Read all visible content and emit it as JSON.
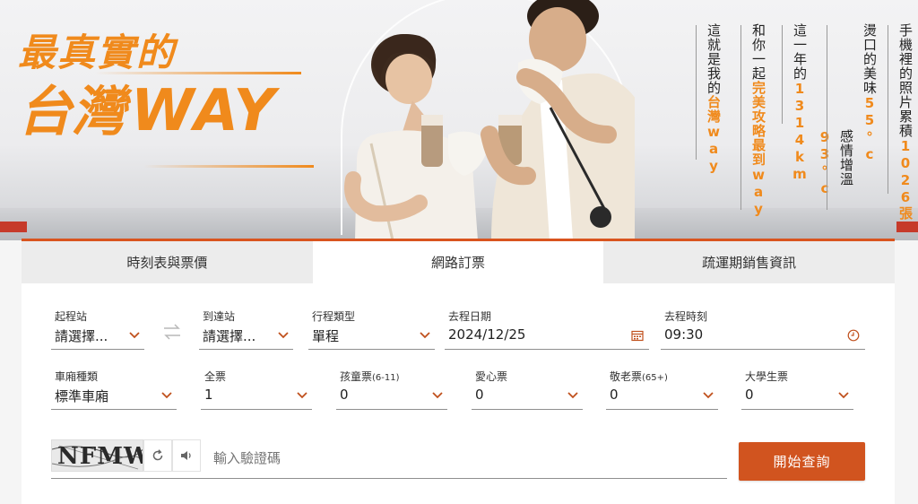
{
  "hero": {
    "slogan_line1": "最真實的",
    "slogan_line2_cn": "台灣",
    "slogan_line2_way": "WAY",
    "columns": [
      {
        "parts": [
          {
            "t": "手機裡的照片累積",
            "hl": false
          },
          {
            "t": "1026",
            "hl": true
          },
          {
            "t": "張",
            "hl": true
          }
        ]
      },
      {
        "parts": [
          {
            "t": "燙口的美味",
            "hl": false
          },
          {
            "t": "55°c",
            "hl": true
          }
        ]
      },
      {
        "parts": [
          {
            "t": "感情增溫",
            "hl": false
          },
          {
            "t": "93°c",
            "hl": true
          }
        ]
      },
      {
        "parts": [
          {
            "t": "這一年的",
            "hl": false
          },
          {
            "t": "1314",
            "hl": true
          },
          {
            "t": "km",
            "hl": true
          }
        ]
      },
      {
        "parts": [
          {
            "t": "和你一起",
            "hl": false
          },
          {
            "t": "完美攻略最到",
            "hl": true
          },
          {
            "t": "way",
            "hl": true
          }
        ]
      },
      {
        "parts": [
          {
            "t": "這就是我的",
            "hl": false
          },
          {
            "t": "台灣",
            "hl": true
          },
          {
            "t": "way",
            "hl": true
          }
        ]
      }
    ]
  },
  "tabs": [
    {
      "label": "時刻表與票價",
      "active": false
    },
    {
      "label": "網路訂票",
      "active": true
    },
    {
      "label": "疏運期銷售資訊",
      "active": false
    }
  ],
  "form": {
    "from": {
      "label": "起程站",
      "value": "請選擇..."
    },
    "to": {
      "label": "到達站",
      "value": "請選擇..."
    },
    "trip_type": {
      "label": "行程類型",
      "value": "單程"
    },
    "date": {
      "label": "去程日期",
      "value": "2024/12/25"
    },
    "time": {
      "label": "去程時刻",
      "value": "09:30"
    },
    "car_type": {
      "label": "車廂種類",
      "value": "標準車廂"
    },
    "adult": {
      "label": "全票",
      "value": "1"
    },
    "child": {
      "label": "孩童票",
      "label_note": "(6-11)",
      "value": "0"
    },
    "disabled": {
      "label": "愛心票",
      "value": "0"
    },
    "senior": {
      "label": "敬老票",
      "label_note": "(65+)",
      "value": "0"
    },
    "student": {
      "label": "大學生票",
      "value": "0"
    }
  },
  "captcha": {
    "image_text": "NFMW",
    "placeholder": "輸入驗證碼"
  },
  "search_label": "開始查詢",
  "colors": {
    "accent": "#d1541f",
    "brand": "#f08a1c"
  }
}
